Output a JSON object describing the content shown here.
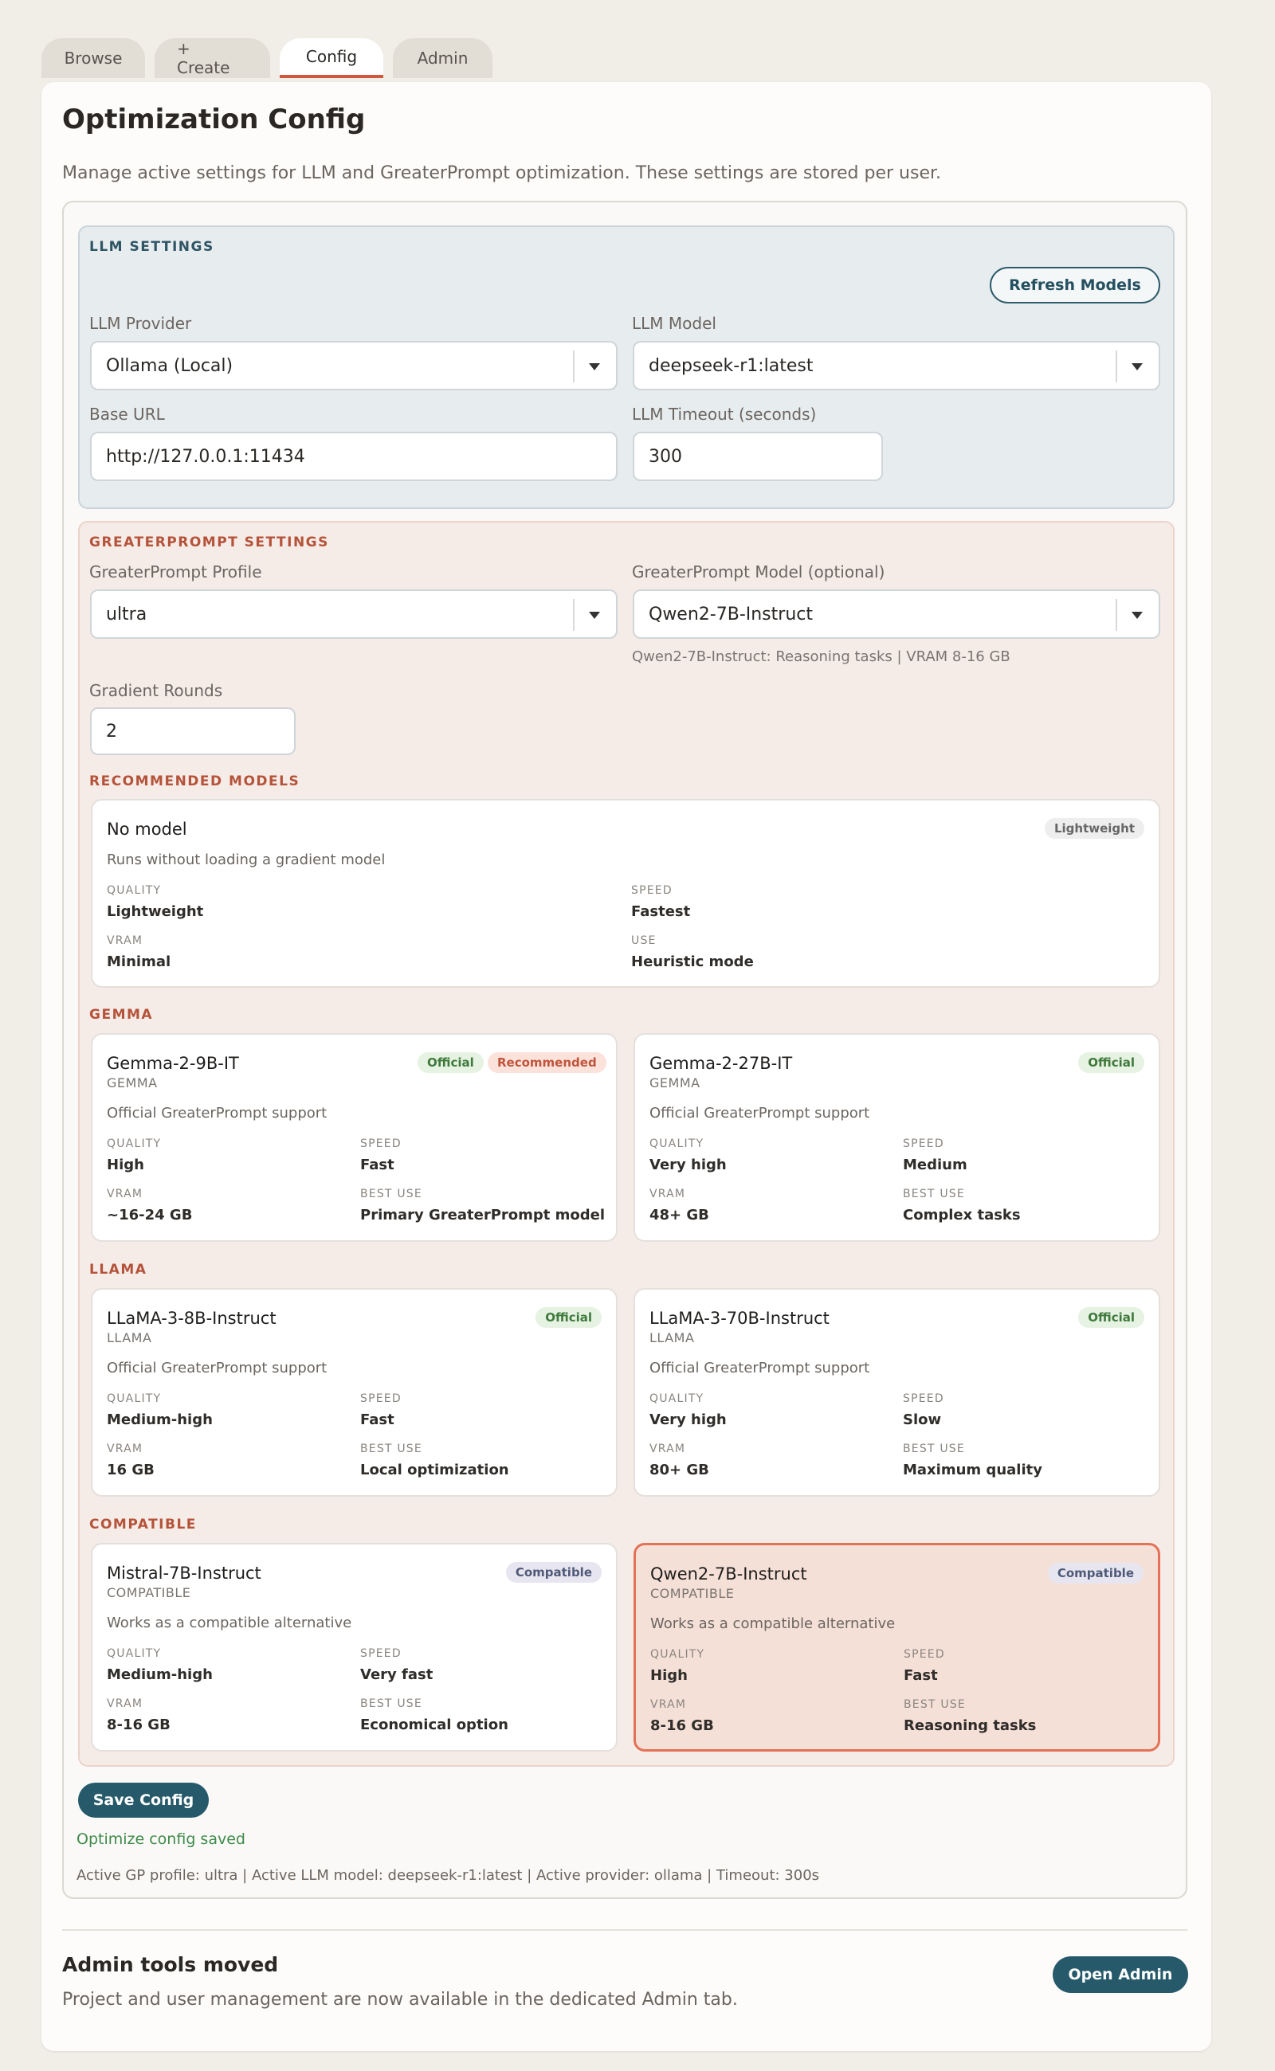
{
  "tabs": [
    "Browse",
    "+ Create",
    "Config",
    "Admin"
  ],
  "page": {
    "title": "Optimization Config",
    "description": "Manage active settings for LLM and GreaterPrompt optimization. These settings are stored per user."
  },
  "llm": {
    "section_label": "LLM SETTINGS",
    "refresh_label": "Refresh Models",
    "provider_label": "LLM Provider",
    "provider_value": "Ollama (Local)",
    "model_label": "LLM Model",
    "model_value": "deepseek-r1:latest",
    "base_url_label": "Base URL",
    "base_url_value": "http://127.0.0.1:11434",
    "timeout_label": "LLM Timeout (seconds)",
    "timeout_value": "300"
  },
  "gp": {
    "section_label": "GREATERPROMPT SETTINGS",
    "profile_label": "GreaterPrompt Profile",
    "profile_value": "ultra",
    "model_label": "GreaterPrompt Model (optional)",
    "model_value": "Qwen2-7B-Instruct",
    "model_hint": "Qwen2-7B-Instruct: Reasoning tasks | VRAM 8-16 GB",
    "rounds_label": "Gradient Rounds",
    "rounds_value": "2",
    "recommended_label": "RECOMMENDED MODELS",
    "gemma_label": "GEMMA",
    "llama_label": "LLAMA",
    "compatible_label": "COMPATIBLE"
  },
  "metric_labels": {
    "quality": "QUALITY",
    "speed": "SPEED",
    "vram": "VRAM",
    "best_use": "BEST USE",
    "use": "USE"
  },
  "cards": {
    "none": {
      "name": "No model",
      "badge": "Lightweight",
      "desc": "Runs without loading a gradient model",
      "quality": "Lightweight",
      "speed": "Fastest",
      "vram": "Minimal",
      "use": "Heuristic mode"
    },
    "gemma9": {
      "name": "Gemma-2-9B-IT",
      "family": "GEMMA",
      "badge1": "Official",
      "badge2": "Recommended",
      "desc": "Official GreaterPrompt support",
      "quality": "High",
      "speed": "Fast",
      "vram": "~16-24 GB",
      "best_use": "Primary GreaterPrompt model"
    },
    "gemma27": {
      "name": "Gemma-2-27B-IT",
      "family": "GEMMA",
      "badge1": "Official",
      "desc": "Official GreaterPrompt support",
      "quality": "Very high",
      "speed": "Medium",
      "vram": "48+ GB",
      "best_use": "Complex tasks"
    },
    "llama8": {
      "name": "LLaMA-3-8B-Instruct",
      "family": "LLAMA",
      "badge1": "Official",
      "desc": "Official GreaterPrompt support",
      "quality": "Medium-high",
      "speed": "Fast",
      "vram": "16 GB",
      "best_use": "Local optimization"
    },
    "llama70": {
      "name": "LLaMA-3-70B-Instruct",
      "family": "LLAMA",
      "badge1": "Official",
      "desc": "Official GreaterPrompt support",
      "quality": "Very high",
      "speed": "Slow",
      "vram": "80+ GB",
      "best_use": "Maximum quality"
    },
    "mistral": {
      "name": "Mistral-7B-Instruct",
      "family": "COMPATIBLE",
      "badge1": "Compatible",
      "desc": "Works as a compatible alternative",
      "quality": "Medium-high",
      "speed": "Very fast",
      "vram": "8-16 GB",
      "best_use": "Economical option"
    },
    "qwen": {
      "name": "Qwen2-7B-Instruct",
      "family": "COMPATIBLE",
      "badge1": "Compatible",
      "desc": "Works as a compatible alternative",
      "quality": "High",
      "speed": "Fast",
      "vram": "8-16 GB",
      "best_use": "Reasoning tasks"
    }
  },
  "footer": {
    "save_label": "Save Config",
    "saved_msg": "Optimize config saved",
    "active_line": "Active GP profile: ultra | Active LLM model: deepseek-r1:latest | Active provider: ollama | Timeout: 300s"
  },
  "admin": {
    "title": "Admin tools moved",
    "desc": "Project and user management are now available in the dedicated Admin tab.",
    "button": "Open Admin"
  }
}
